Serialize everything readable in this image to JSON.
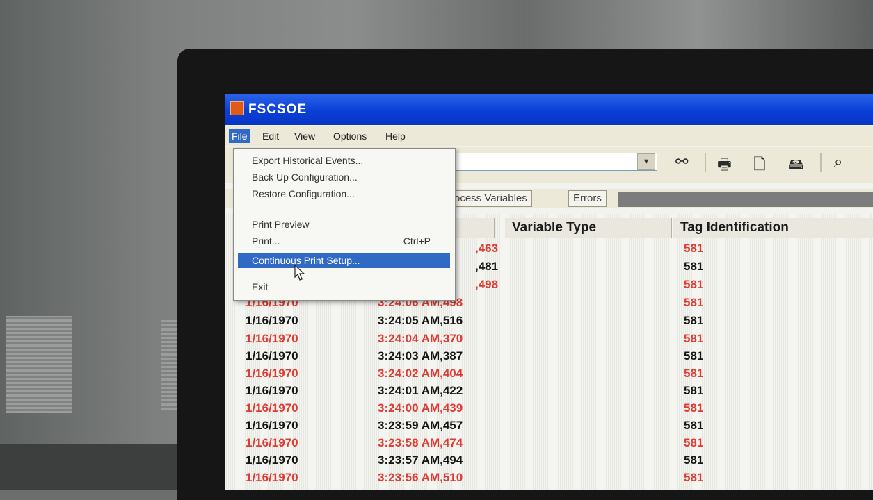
{
  "window": {
    "title": "FSCSOE"
  },
  "menubar": {
    "items": [
      "File",
      "Edit",
      "View",
      "Options",
      "Help"
    ]
  },
  "file_menu": {
    "items": [
      {
        "label": "Export Historical Events..."
      },
      {
        "label": "Back Up Configuration..."
      },
      {
        "label": "Restore Configuration..."
      },
      {
        "label": "Print Preview"
      },
      {
        "label": "Print...",
        "shortcut": "Ctrl+P"
      },
      {
        "label": "Continuous Print Setup...",
        "selected": true
      },
      {
        "label": "Exit"
      }
    ]
  },
  "toolbar": {
    "icons": [
      "find-binoculars-icon",
      "print-icon",
      "print-preview-icon",
      "export-icon"
    ]
  },
  "tabs": {
    "items": [
      "rocess Variables",
      "Errors"
    ]
  },
  "table": {
    "headers": [
      "Variable Type",
      "Tag Identification"
    ],
    "partial_rows": [
      {
        "time": ",463",
        "tag": "581",
        "color": "red"
      },
      {
        "time": ",481",
        "tag": "581",
        "color": "black"
      },
      {
        "time": ",498",
        "tag": "581",
        "color": "red"
      },
      {
        "date": "1/16/1970",
        "time": "3:24:06 AM,498",
        "tag": "581",
        "color": "red"
      }
    ],
    "rows": [
      {
        "date": "1/16/1970",
        "time": "3:24:05 AM,516",
        "tag": "581",
        "color": "black"
      },
      {
        "date": "1/16/1970",
        "time": "3:24:04 AM,370",
        "tag": "581",
        "color": "red"
      },
      {
        "date": "1/16/1970",
        "time": "3:24:03 AM,387",
        "tag": "581",
        "color": "black"
      },
      {
        "date": "1/16/1970",
        "time": "3:24:02 AM,404",
        "tag": "581",
        "color": "red"
      },
      {
        "date": "1/16/1970",
        "time": "3:24:01 AM,422",
        "tag": "581",
        "color": "black"
      },
      {
        "date": "1/16/1970",
        "time": "3:24:00 AM,439",
        "tag": "581",
        "color": "red"
      },
      {
        "date": "1/16/1970",
        "time": "3:23:59 AM,457",
        "tag": "581",
        "color": "black"
      },
      {
        "date": "1/16/1970",
        "time": "3:23:58 AM,474",
        "tag": "581",
        "color": "red"
      },
      {
        "date": "1/16/1970",
        "time": "3:23:57 AM,494",
        "tag": "581",
        "color": "black"
      },
      {
        "date": "1/16/1970",
        "time": "3:23:56 AM,510",
        "tag": "581",
        "color": "red"
      }
    ]
  },
  "colors": {
    "titlebar": "#0a3fd6",
    "selection": "#316ac5",
    "red_text": "#df3b32",
    "black_text": "#151515"
  }
}
